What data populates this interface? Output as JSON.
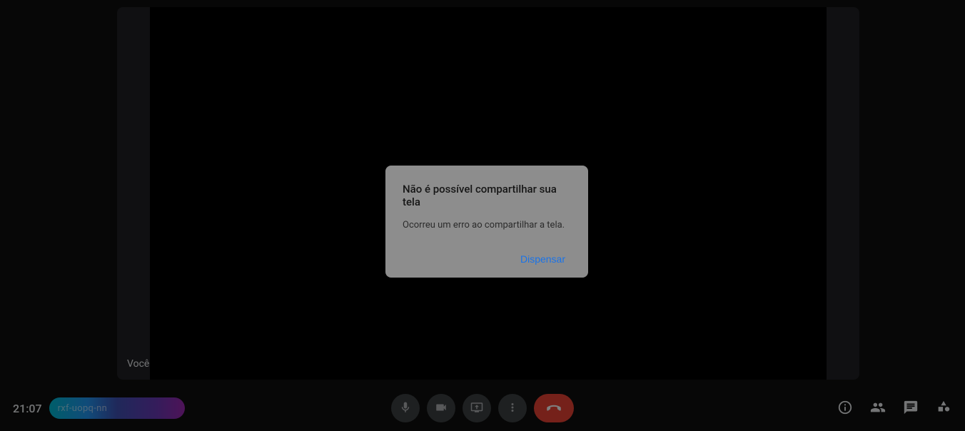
{
  "video": {
    "participant_label": "Você"
  },
  "dialog": {
    "title": "Não é possível compartilhar sua tela",
    "body": "Ocorreu um erro ao compartilhar a tela.",
    "dismiss_label": "Dispensar"
  },
  "footer": {
    "clock": "21:07",
    "meeting_code": "rxf-uopq-nn"
  }
}
